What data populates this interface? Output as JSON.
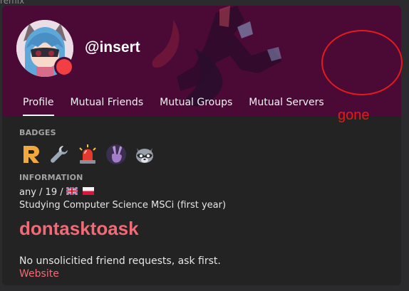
{
  "background": {
    "partial_text": "remix"
  },
  "profile": {
    "username": "@insert",
    "status_color": "#f23f43",
    "banner_color": "#4a0a35"
  },
  "tabs": [
    {
      "label": "Profile",
      "active": true
    },
    {
      "label": "Mutual Friends",
      "active": false
    },
    {
      "label": "Mutual Groups",
      "active": false
    },
    {
      "label": "Mutual Servers",
      "active": false
    }
  ],
  "badges": {
    "title": "BADGES",
    "items": [
      "r-letter-badge-icon",
      "wrench-icon",
      "rotating-light-icon",
      "victory-hand-icon",
      "raccoon-icon"
    ]
  },
  "information": {
    "title": "INFORMATION",
    "line1": "any / 19 /",
    "flags": [
      "uk-flag-icon",
      "poland-flag-icon"
    ],
    "line2": "Studying Computer Science MSCi (first year)"
  },
  "bio": {
    "heading": "dontasktoask",
    "text": "No unsolicitied friend requests, ask first.",
    "link": "Website"
  },
  "annotation": {
    "text": "gone",
    "color": "#e41b1b"
  }
}
